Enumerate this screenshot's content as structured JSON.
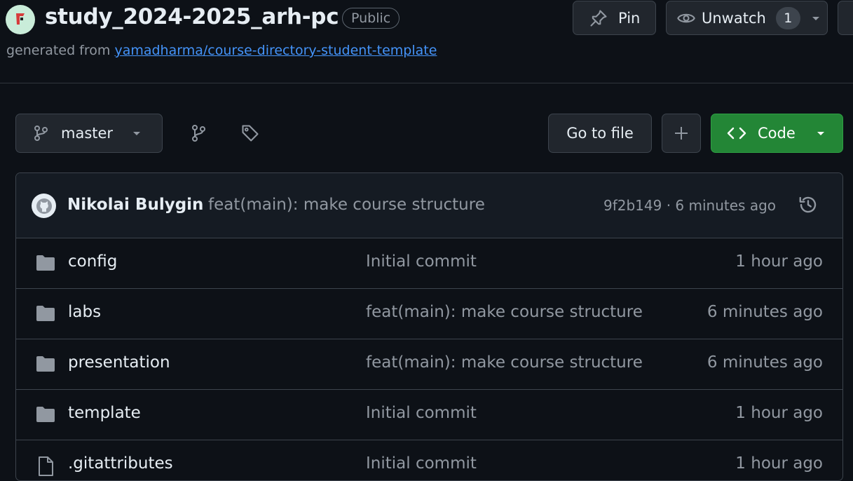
{
  "repo": {
    "name": "study_2024-2025_arh-pc",
    "visibility": "Public",
    "generated_prefix": "generated from",
    "template_link": "yamadharma/course-directory-student-template"
  },
  "actions": {
    "pin_label": "Pin",
    "unwatch_label": "Unwatch",
    "watch_count": "1"
  },
  "toolbar": {
    "branch": "master",
    "go_to_file": "Go to file",
    "add_icon": "plus-icon",
    "code_label": "Code",
    "code_color": "#238636"
  },
  "last_commit": {
    "author": "Nikolai Bulygin",
    "message": "feat(main): make course structure",
    "hash_time": "9f2b149 · 6 minutes ago"
  },
  "files": [
    {
      "name": "config",
      "message": "Initial commit",
      "time": "1 hour ago",
      "type": "folder"
    },
    {
      "name": "labs",
      "message": "feat(main): make course structure",
      "time": "6 minutes ago",
      "type": "folder"
    },
    {
      "name": "presentation",
      "message": "feat(main): make course structure",
      "time": "6 minutes ago",
      "type": "folder"
    },
    {
      "name": "template",
      "message": "Initial commit",
      "time": "1 hour ago",
      "type": "folder"
    },
    {
      "name": ".gitattributes",
      "message": "Initial commit",
      "time": "1 hour ago",
      "type": "file"
    }
  ]
}
